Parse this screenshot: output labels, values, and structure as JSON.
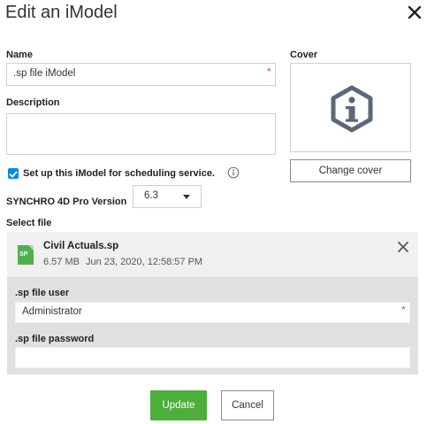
{
  "dialog": {
    "title": "Edit an iModel"
  },
  "name": {
    "label": "Name",
    "value": ".sp file iModel",
    "required_mark": "*"
  },
  "description": {
    "label": "Description",
    "value": ""
  },
  "cover": {
    "label": "Cover",
    "change_label": "Change cover"
  },
  "scheduling": {
    "label": "Set up this iModel for scheduling service.",
    "checked": true
  },
  "version": {
    "label": "SYNCHRO 4D Pro Version",
    "selected": "6.3"
  },
  "file": {
    "section_label": "Select file",
    "icon_text": "SP",
    "name": "Civil Actuals.sp",
    "size": "6.57 MB",
    "date": "Jun 23, 2020, 12:58:57 PM"
  },
  "sp_user": {
    "label": ".sp file user",
    "value": "Administrator",
    "required_mark": "*"
  },
  "sp_password": {
    "label": ".sp file password",
    "value": ""
  },
  "actions": {
    "update": "Update",
    "cancel": "Cancel"
  },
  "colors": {
    "primary": "#4caf39",
    "checkbox": "#008be1",
    "file_icon": "#4faf4f",
    "cover_icon": "#5a6877",
    "required": "#d9534f"
  }
}
